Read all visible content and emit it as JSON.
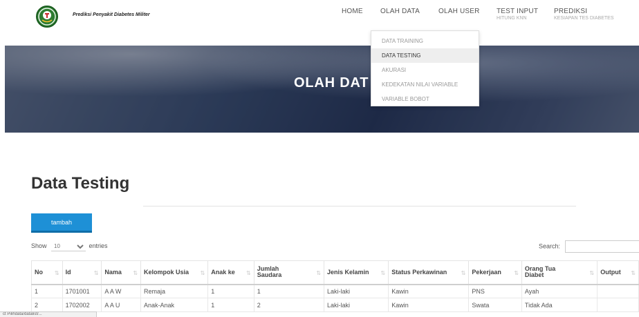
{
  "header": {
    "brand": "Prediksi Penyakit Diabetes Militer",
    "nav": [
      {
        "label": "HOME",
        "sub": ""
      },
      {
        "label": "OLAH DATA",
        "sub": ""
      },
      {
        "label": "OLAH USER",
        "sub": ""
      },
      {
        "label": "TEST INPUT",
        "sub": "HITUNG KNN"
      },
      {
        "label": "PREDIKSI",
        "sub": "KESIAPAN TES DIABETES"
      }
    ]
  },
  "dropdown": {
    "items": [
      "DATA TRAINING",
      "DATA TESTING",
      "AKURASI",
      "KEDEKATAN NILAI VARIABLE",
      "VARIABLE BOBOT"
    ],
    "active": "DATA TESTING"
  },
  "hero": {
    "title": "OLAH DAT"
  },
  "content": {
    "title": "Data Testing",
    "add_button": "tambah",
    "show_label": "Show",
    "entries_value": "10",
    "entries_label": "entries",
    "search_label": "Search:"
  },
  "table": {
    "columns": [
      "No",
      "Id",
      "Nama",
      "Kelompok Usia",
      "Anak ke",
      "Jumlah Saudara",
      "Jenis Kelamin",
      "Status Perkawinan",
      "Pekerjaan",
      "Orang Tua Diabet",
      "Output"
    ],
    "rows": [
      [
        "1",
        "1701001",
        "A A W",
        "Remaja",
        "1",
        "1",
        "Laki-laki",
        "Kawin",
        "PNS",
        "Ayah",
        ""
      ],
      [
        "2",
        "1702002",
        "A A U",
        "Anak-Anak",
        "1",
        "2",
        "Laki-laki",
        "Kawin",
        "Swata",
        "Tidak Ada",
        ""
      ]
    ]
  },
  "status_bar": {
    "text": "ct Pilihdata/datalist/..."
  }
}
